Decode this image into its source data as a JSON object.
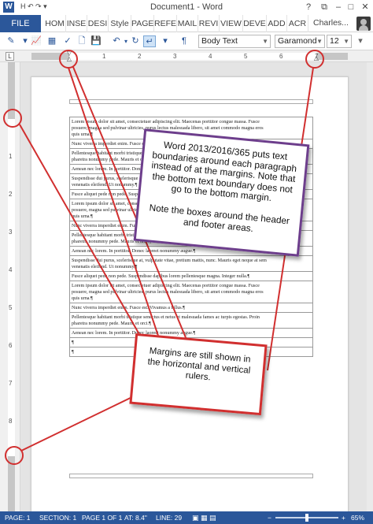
{
  "window": {
    "title": "Document1 - Word",
    "logo_letter": "W",
    "qat": "H ↶ ↷ ▾"
  },
  "tabs": {
    "file": "FILE",
    "items": [
      "HOM",
      "INSE",
      "DESI",
      "Style",
      "PAGE",
      "REFE",
      "MAIL",
      "REVI",
      "VIEW",
      "DEVE",
      "ADD",
      "ACR"
    ],
    "user": "Charles..."
  },
  "toolbar": {
    "style": "Body Text",
    "font": "Garamond",
    "size": "12",
    "zoom": "65%"
  },
  "ruler": {
    "h_numbers": [
      "1",
      "2",
      "3",
      "4",
      "5",
      "6",
      "7"
    ],
    "v_numbers": [
      "1",
      "2",
      "3",
      "4",
      "5",
      "6",
      "7",
      "8"
    ]
  },
  "document": {
    "paragraphs": [
      [
        "Lorem ipsum dolor sit amet, consectetuer adipiscing elit. Maecenas porttitor congue massa. Fusce",
        "posuere, magna sed pulvinar ultricies, purus lectus malesuada libero, sit amet commodo magna eros",
        "quis urna.¶"
      ],
      [
        "Nunc viverra imperdiet enim. Fusce est. Vivamus a tellus.¶"
      ],
      [
        "Pellentesque habitant morbi tristique senectus et netus et malesuada fames ac turpis egestas. Proin",
        "pharetra nonummy pede. Mauris et orci.¶"
      ],
      [
        "Aenean nec lorem. In porttitor. Donec laoreet nonummy augue.¶"
      ],
      [
        "Suspendisse dui purus, scelerisque at, vulputate vitae, pretium mattis, nunc. Mauris eget neque at sem",
        "venenatis eleifend. Ut nonummy.¶"
      ],
      [
        "Fusce aliquet pede non pede. Suspendisse dapibus lorem pellentesque magna. Integer nulla.¶"
      ],
      [
        "Lorem ipsum dolor sit amet, consectetuer adipiscing elit. Maecenas porttitor congue massa. Fusce",
        "posuere, magna sed pulvinar ultricies, purus lectus malesuada libero, sit amet commodo magna eros",
        "quis urna.¶"
      ],
      [
        "Nunc viverra imperdiet enim. Fusce est. Vivamus a tellus.¶"
      ],
      [
        "Pellentesque habitant morbi tristique senectus et netus et malesuada fames ac turpis egestas. Proin",
        "pharetra nonummy pede. Mauris et orci.¶"
      ],
      [
        "Aenean nec lorem. In porttitor. Donec laoreet nonummy augue.¶"
      ],
      [
        "Suspendisse dui purus, scelerisque at, vulputate vitae, pretium mattis, nunc. Mauris eget neque at sem",
        "venenatis eleifend. Ut nonummy.¶"
      ],
      [
        "Fusce aliquet pede non pede. Suspendisse dapibus lorem pellentesque magna. Integer nulla.¶"
      ],
      [
        "Lorem ipsum dolor sit amet, consectetuer adipiscing elit. Maecenas porttitor congue massa. Fusce",
        "posuere, magna sed pulvinar ultricies, purus lectus malesuada libero, sit amet commodo magna eros",
        "quis urna.¶"
      ],
      [
        "Nunc viverra imperdiet enim. Fusce est. Vivamus a tellus.¶"
      ],
      [
        "Pellentesque habitant morbi tristique senectus et netus et malesuada fames ac turpis egestas. Proin",
        "pharetra nonummy pede. Mauris et orci.¶"
      ],
      [
        "Aenean nec lorem. In porttitor. Donec laoreet nonummy augue.¶"
      ],
      [
        "¶"
      ],
      [
        "¶"
      ]
    ]
  },
  "callouts": {
    "boundaries": "Word 2013/2016/365 puts text boundaries around each paragraph instead of at the margins. Note that the bottom text boundary does not go to the bottom margin.\n\nNote the boxes around the header and footer areas.",
    "margins": "Margins are still shown in the horizontal and vertical rulers."
  },
  "status": {
    "page": "PAGE: 1",
    "section": "SECTION: 1",
    "pageof": "PAGE 1 OF 1",
    "at": "AT: 8.4\"",
    "line": "LINE: 29"
  },
  "colors": {
    "word_blue": "#2b579a",
    "callout_red": "#d12f2f",
    "callout_purple": "#6d3e8c"
  }
}
